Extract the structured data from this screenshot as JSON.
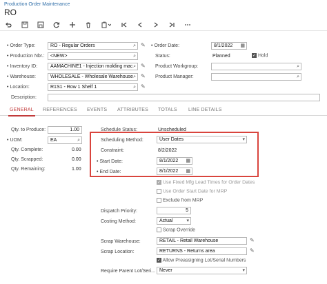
{
  "breadcrumb": "Production Order Maintenance",
  "title": "RO",
  "header": {
    "order_type": {
      "label": "Order Type:",
      "value": "RO - Regular Orders"
    },
    "production_nbr": {
      "label": "Production Nbr.:",
      "value": "<NEW>"
    },
    "inventory_id": {
      "label": "Inventory ID:",
      "value": "AAMACHINE1 - Injection molding mac"
    },
    "warehouse": {
      "label": "Warehouse:",
      "value": "WHOLESALE - Wholesale Warehouse"
    },
    "location": {
      "label": "Location:",
      "value": "R1S1 - Row 1 Shelf 1"
    },
    "description": {
      "label": "Description:",
      "value": ""
    },
    "order_date": {
      "label": "Order Date:",
      "value": "8/1/2022"
    },
    "status": {
      "label": "Status:",
      "value": "Planned"
    },
    "hold": {
      "label": "Hold",
      "checked": true
    },
    "product_workgroup": {
      "label": "Product Workgroup:",
      "value": ""
    },
    "product_manager": {
      "label": "Product Manager:",
      "value": ""
    }
  },
  "tabs": [
    "GENERAL",
    "REFERENCES",
    "EVENTS",
    "ATTRIBUTES",
    "TOTALS",
    "LINE DETAILS"
  ],
  "general": {
    "qty_to_produce": {
      "label": "Qty. to Produce:",
      "value": "1.00"
    },
    "uom": {
      "label": "UOM:",
      "value": "EA"
    },
    "qty_complete": {
      "label": "Qty. Complete:",
      "value": "0.00"
    },
    "qty_scrapped": {
      "label": "Qty. Scrapped:",
      "value": "0.00"
    },
    "qty_remaining": {
      "label": "Qty. Remaining:",
      "value": "1.00"
    },
    "schedule_status": {
      "label": "Schedule Status:",
      "value": "Unscheduled"
    },
    "scheduling_method": {
      "label": "Scheduling Method:",
      "value": "User Dates"
    },
    "constraint": {
      "label": "Constraint:",
      "value": "8/2/2022"
    },
    "start_date": {
      "label": "Start Date:",
      "value": "8/1/2022"
    },
    "end_date": {
      "label": "End Date:",
      "value": "8/1/2022"
    },
    "use_fixed_mfg": {
      "label": "Use Fixed Mfg Lead Times for Order Dates",
      "checked": true
    },
    "use_order_start": {
      "label": "Use Order Start Date for MRP",
      "checked": false
    },
    "exclude_mrp": {
      "label": "Exclude from MRP",
      "checked": false
    },
    "dispatch_priority": {
      "label": "Dispatch Priority:",
      "value": "5"
    },
    "costing_method": {
      "label": "Costing Method:",
      "value": "Actual"
    },
    "scrap_override": {
      "label": "Scrap Override",
      "checked": false
    },
    "scrap_warehouse": {
      "label": "Scrap Warehouse:",
      "value": "RETAIL - Retail Warehouse"
    },
    "scrap_location": {
      "label": "Scrap Location:",
      "value": "RETURNS - Returns area"
    },
    "allow_preassign": {
      "label": "Allow Preassigning Lot/Serial Numbers",
      "checked": true
    },
    "require_parent": {
      "label": "Require Parent Lot/Seri...",
      "value": "Never"
    }
  },
  "colors": {
    "accent": "#c23a3a",
    "link": "#2f6ea8",
    "highlight_box": "#d9443d"
  }
}
